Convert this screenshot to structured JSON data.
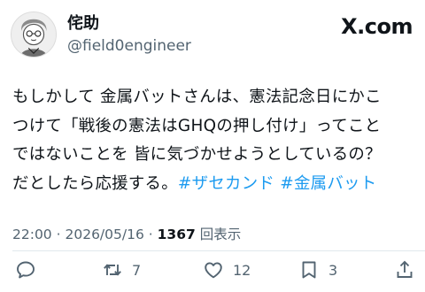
{
  "author": {
    "name": "侘助",
    "handle": "@field0engineer",
    "avatar_icon": "avatar-illustration"
  },
  "brand": "X.com",
  "tweet": {
    "text_plain": "もしかして 金属バットさんは、憲法記念日にかこ\nつけて「戦後の憲法はGHQの押し付け」ってこと\nではないことを 皆に気づかせようとしているの？\nだとしたら応援する。",
    "hashtags": [
      "#ザセカンド",
      "#金属バット"
    ]
  },
  "meta": {
    "time": "22:00",
    "separator": "·",
    "date": "2026/05/16",
    "views_count": "1367",
    "views_label": "回表示"
  },
  "actions": {
    "reply": {
      "icon": "reply-icon",
      "count": ""
    },
    "retweet": {
      "icon": "retweet-icon",
      "count": "7"
    },
    "like": {
      "icon": "heart-icon",
      "count": "12"
    },
    "bookmark": {
      "icon": "bookmark-icon",
      "count": "3"
    },
    "share": {
      "icon": "share-icon",
      "count": ""
    }
  },
  "colors": {
    "text": "#0f1419",
    "secondary": "#536471",
    "hashtag": "#1d9bf0"
  }
}
